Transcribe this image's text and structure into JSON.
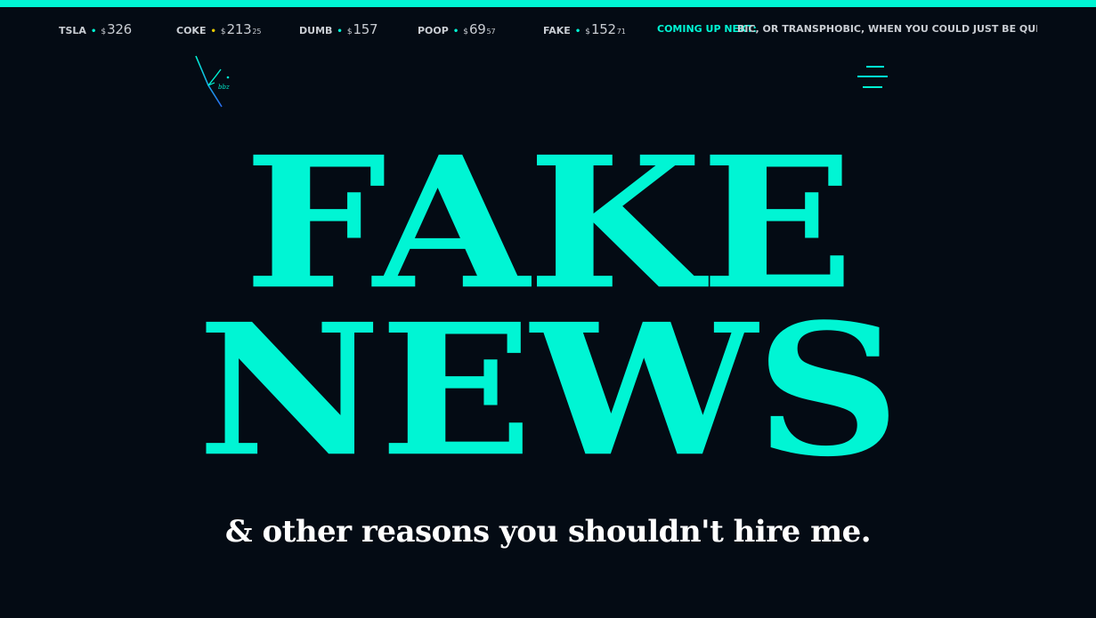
{
  "colors": {
    "background": "#040b14",
    "accent": "#00f5d4",
    "text": "#ffffff",
    "ticker_text": "#c9cdd3"
  },
  "ticker": {
    "items": [
      {
        "symbol": "TSLA",
        "currency": "$",
        "int": "326",
        "dec": "",
        "dot_color": "#00f5d4"
      },
      {
        "symbol": "COKE",
        "currency": "$",
        "int": "213",
        "dec": "25",
        "dot_color": "#e6c800"
      },
      {
        "symbol": "DUMB",
        "currency": "$",
        "int": "157",
        "dec": "",
        "dot_color": "#00f5d4"
      },
      {
        "symbol": "POOP",
        "currency": "$",
        "int": "69",
        "dec": "57",
        "dot_color": "#00f5d4"
      },
      {
        "symbol": "FAKE",
        "currency": "$",
        "int": "152",
        "dec": "71",
        "dot_color": "#00f5d4"
      }
    ],
    "coming_up_label": "COMING UP NEXT:",
    "headline": "BIC, OR TRANSPHOBIC, WHEN YOU COULD JUST BE QUIET? • NR"
  },
  "nav": {
    "logo_icon": "signature-logo-icon",
    "menu_icon": "hamburger-menu-icon"
  },
  "hero": {
    "line1": "FAKE",
    "line2": "NEWS",
    "tagline": "& other reasons you shouldn't hire me."
  }
}
